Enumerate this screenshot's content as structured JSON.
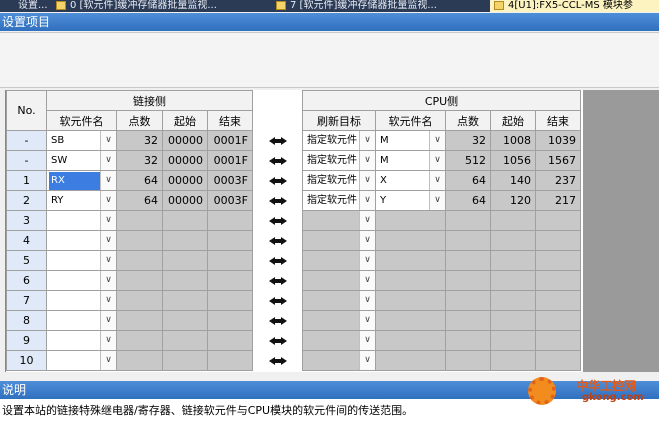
{
  "tabs": [
    {
      "label": "设置..."
    },
    {
      "label": "0 [软元件]缓冲存储器批量监视..."
    },
    {
      "label": "7 [软元件]缓冲存储器批量监视..."
    },
    {
      "label": "4[U1]:FX5-CCL-MS 模块参"
    }
  ],
  "section_title": "设置项目",
  "table": {
    "no_header": "No.",
    "link_side_header": "链接侧",
    "cpu_side_header": "CPU侧",
    "link_cols": [
      "软元件名",
      "点数",
      "起始",
      "结束"
    ],
    "cpu_cols": [
      "刷新目标",
      "软元件名",
      "点数",
      "起始",
      "结束"
    ],
    "rows": [
      {
        "no": "-",
        "link_dev": "SB",
        "link_points": "32",
        "link_start": "00000",
        "link_end": "0001F",
        "target": "指定软元件",
        "cpu_dev": "M",
        "cpu_points": "32",
        "cpu_start": "1008",
        "cpu_end": "1039"
      },
      {
        "no": "-",
        "link_dev": "SW",
        "link_points": "32",
        "link_start": "00000",
        "link_end": "0001F",
        "target": "指定软元件",
        "cpu_dev": "M",
        "cpu_points": "512",
        "cpu_start": "1056",
        "cpu_end": "1567"
      },
      {
        "no": "1",
        "link_dev": "RX",
        "link_points": "64",
        "link_start": "00000",
        "link_end": "0003F",
        "target": "指定软元件",
        "cpu_dev": "X",
        "cpu_points": "64",
        "cpu_start": "140",
        "cpu_end": "237"
      },
      {
        "no": "2",
        "link_dev": "RY",
        "link_points": "64",
        "link_start": "00000",
        "link_end": "0003F",
        "target": "指定软元件",
        "cpu_dev": "Y",
        "cpu_points": "64",
        "cpu_start": "120",
        "cpu_end": "217"
      },
      {
        "no": "3"
      },
      {
        "no": "4"
      },
      {
        "no": "5"
      },
      {
        "no": "6"
      },
      {
        "no": "7"
      },
      {
        "no": "8"
      },
      {
        "no": "9"
      },
      {
        "no": "10"
      }
    ]
  },
  "description": {
    "title": "说明",
    "text": "设置本站的链接特殊继电器/寄存器、链接软元件与CPU模块的软元件间的传送范围。"
  },
  "watermark": {
    "text": "中华工控网",
    "sub": "gkong.com"
  },
  "colors": {
    "header_blue": "#2f6fbf",
    "selected": "#3b7de0",
    "gray_cell": "#c8c8c8"
  }
}
